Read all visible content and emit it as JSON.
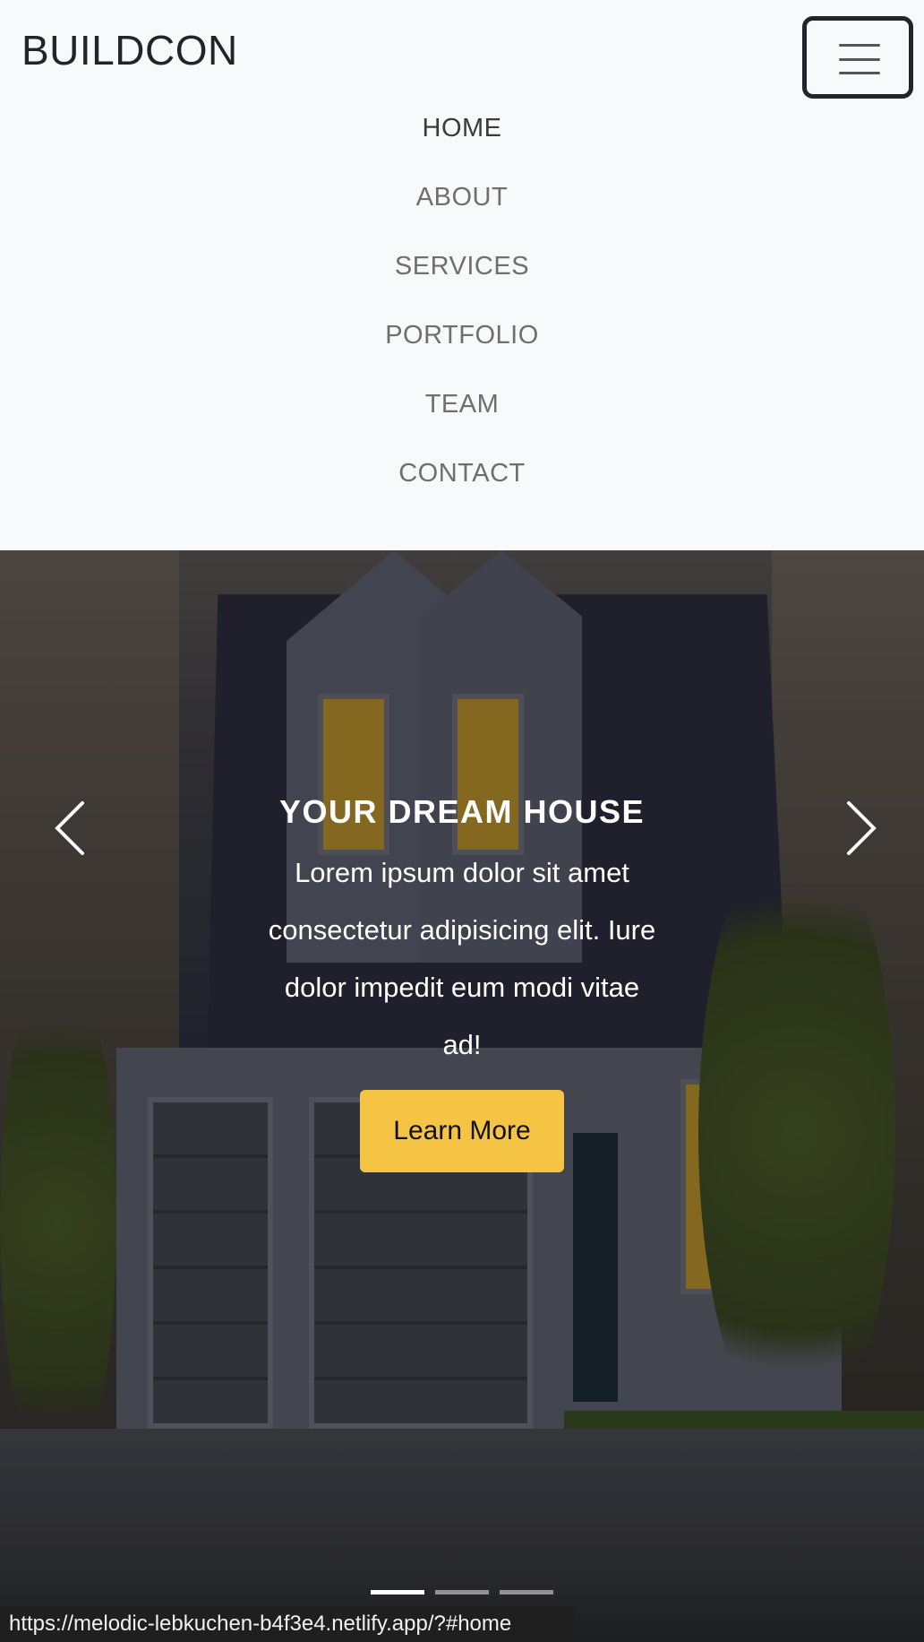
{
  "navbar": {
    "brand": "BUILDCON",
    "toggler_label": "Toggle navigation",
    "items": [
      {
        "label": "HOME",
        "active": true
      },
      {
        "label": "ABOUT",
        "active": false
      },
      {
        "label": "SERVICES",
        "active": false
      },
      {
        "label": "PORTFOLIO",
        "active": false
      },
      {
        "label": "TEAM",
        "active": false
      },
      {
        "label": "CONTACT",
        "active": false
      }
    ]
  },
  "hero": {
    "title": "YOUR DREAM HOUSE",
    "text": "Lorem ipsum dolor sit amet consectetur adipisicing elit. Iure dolor impedit eum modi vitae ad!",
    "button_label": "Learn More",
    "prev_icon": "chevron-left-icon",
    "next_icon": "chevron-right-icon",
    "slide_count": 3,
    "active_slide": 1
  },
  "status_bar": {
    "url": "https://melodic-lebkuchen-b4f3e4.netlify.app/?#home"
  },
  "colors": {
    "navbar_bg": "#f8f9fa",
    "accent_button": "#f6c445",
    "brand_text": "#212529"
  }
}
